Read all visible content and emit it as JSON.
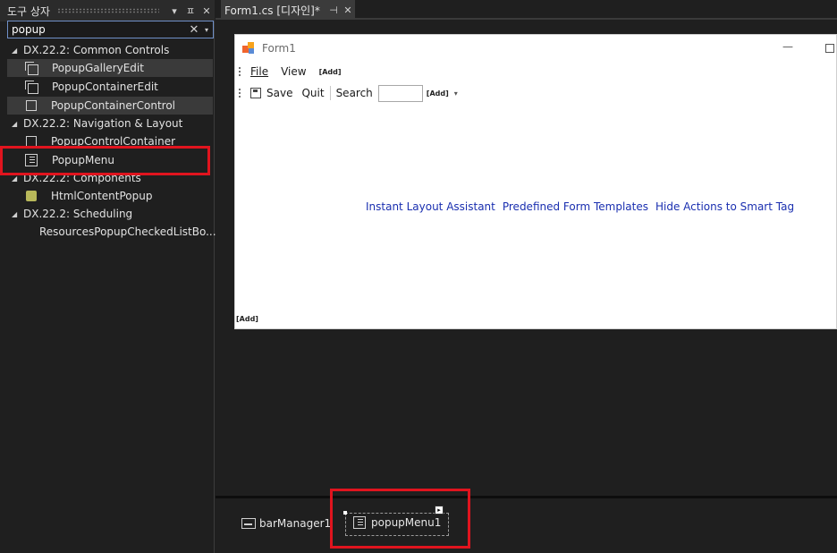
{
  "toolbox": {
    "title": "도구 상자",
    "header_buttons": {
      "dropdown": "▾",
      "pin": "ㅍ",
      "close": "✕"
    },
    "search_value": "popup",
    "search_clear": "✕",
    "search_dropdown": "▾",
    "collapse_glyph": "◢",
    "categories": [
      {
        "label": "DX.22.2: Common Controls",
        "items": [
          {
            "label": "PopupGalleryEdit",
            "icon": "gallery-icon",
            "selected": true
          },
          {
            "label": "PopupContainerEdit",
            "icon": "container-edit-icon",
            "selected": false
          },
          {
            "label": "PopupContainerControl",
            "icon": "square-icon",
            "selected": true
          }
        ]
      },
      {
        "label": "DX.22.2: Navigation & Layout",
        "items": [
          {
            "label": "PopupControlContainer",
            "icon": "square-icon",
            "selected": false
          },
          {
            "label": "PopupMenu",
            "icon": "menu-icon",
            "selected": false,
            "highlighted": true
          }
        ]
      },
      {
        "label": "DX.22.2: Components",
        "items": [
          {
            "label": "HtmlContentPopup",
            "icon": "html-icon",
            "selected": false
          }
        ]
      },
      {
        "label": "DX.22.2: Scheduling",
        "items": [
          {
            "label": "ResourcesPopupCheckedListBo...",
            "icon": "list-icon",
            "selected": false
          }
        ]
      }
    ]
  },
  "document_tab": {
    "label": "Form1.cs [디자인]*",
    "pin": "⊣",
    "close": "✕"
  },
  "form": {
    "title": "Form1",
    "min_glyph": "—",
    "menu": {
      "file": "File",
      "view": "View",
      "add": "[Add]"
    },
    "toolbar": {
      "save": "Save",
      "quit": "Quit",
      "search_label": "Search",
      "add": "[Add]",
      "caret": "▾"
    },
    "smart_links": [
      "Instant Layout Assistant",
      "Predefined Form Templates",
      "Hide Actions to Smart Tag"
    ],
    "bottom_add": "[Add]"
  },
  "tray": {
    "items": [
      {
        "label": "barManager1",
        "icon": "bar-manager-icon"
      },
      {
        "label": "popupMenu1",
        "icon": "menu-icon",
        "selected": true
      }
    ],
    "smart_tag": "▸"
  },
  "colors": {
    "highlight_box": "#e0141e",
    "link": "#1a2fb0",
    "panel_bg": "#1f1f1f"
  }
}
